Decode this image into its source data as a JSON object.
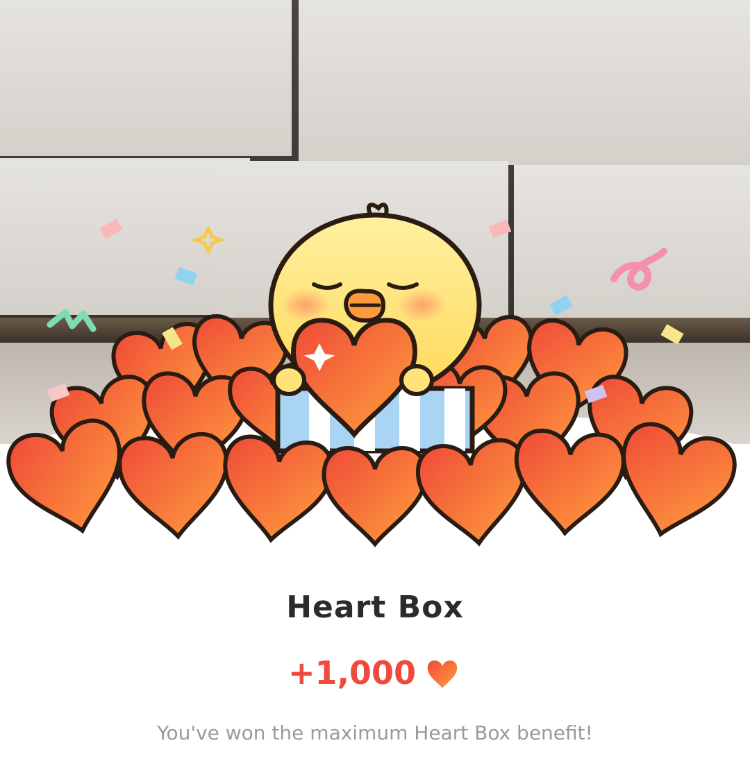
{
  "reward": {
    "title": "Heart Box",
    "amount": "+1,000",
    "message": "You've won the maximum Heart Box benefit!"
  },
  "icons": {
    "amount_icon": "heart-icon",
    "illustration": "chick-holding-heart-illustration",
    "background": "group-photo-posters"
  },
  "colors": {
    "amount": "#f04a3e",
    "title": "#2b2b2b",
    "message": "#9a9a9a",
    "heart_top": "#f25a3f",
    "heart_bottom": "#ff9a3c",
    "chick": "#ffe37a"
  }
}
